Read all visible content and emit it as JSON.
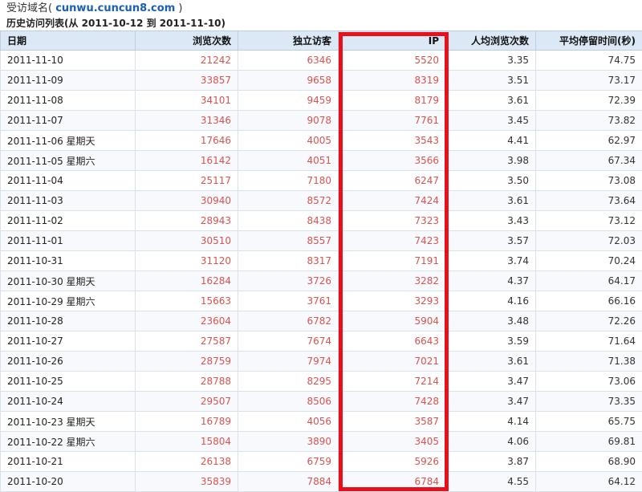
{
  "header": {
    "domain_label": "受访域名(",
    "domain": "cunwu.cuncun8.com",
    "domain_close": ")",
    "history_label": "历史访问列表(从 2011-10-12 到 2011-11-10)"
  },
  "table": {
    "columns": [
      "日期",
      "浏览次数",
      "独立访客",
      "IP",
      "人均浏览次数",
      "平均停留时间(秒)"
    ],
    "rows": [
      {
        "date": "2011-11-10",
        "pv": "21242",
        "uv": "6346",
        "ip": "5520",
        "avg_pv": "3.35",
        "avg_time": "74.75"
      },
      {
        "date": "2011-11-09",
        "pv": "33857",
        "uv": "9658",
        "ip": "8319",
        "avg_pv": "3.51",
        "avg_time": "73.17"
      },
      {
        "date": "2011-11-08",
        "pv": "34101",
        "uv": "9459",
        "ip": "8179",
        "avg_pv": "3.61",
        "avg_time": "72.39"
      },
      {
        "date": "2011-11-07",
        "pv": "31346",
        "uv": "9078",
        "ip": "7761",
        "avg_pv": "3.45",
        "avg_time": "73.82"
      },
      {
        "date": "2011-11-06 星期天",
        "pv": "17646",
        "uv": "4005",
        "ip": "3543",
        "avg_pv": "4.41",
        "avg_time": "62.97"
      },
      {
        "date": "2011-11-05 星期六",
        "pv": "16142",
        "uv": "4051",
        "ip": "3566",
        "avg_pv": "3.98",
        "avg_time": "67.34"
      },
      {
        "date": "2011-11-04",
        "pv": "25117",
        "uv": "7180",
        "ip": "6247",
        "avg_pv": "3.50",
        "avg_time": "73.08"
      },
      {
        "date": "2011-11-03",
        "pv": "30940",
        "uv": "8572",
        "ip": "7424",
        "avg_pv": "3.61",
        "avg_time": "73.64"
      },
      {
        "date": "2011-11-02",
        "pv": "28943",
        "uv": "8438",
        "ip": "7323",
        "avg_pv": "3.43",
        "avg_time": "73.12"
      },
      {
        "date": "2011-11-01",
        "pv": "30510",
        "uv": "8557",
        "ip": "7423",
        "avg_pv": "3.57",
        "avg_time": "72.03"
      },
      {
        "date": "2011-10-31",
        "pv": "31120",
        "uv": "8317",
        "ip": "7191",
        "avg_pv": "3.74",
        "avg_time": "70.24"
      },
      {
        "date": "2011-10-30 星期天",
        "pv": "16284",
        "uv": "3726",
        "ip": "3282",
        "avg_pv": "4.37",
        "avg_time": "64.17"
      },
      {
        "date": "2011-10-29 星期六",
        "pv": "15663",
        "uv": "3761",
        "ip": "3293",
        "avg_pv": "4.16",
        "avg_time": "66.16"
      },
      {
        "date": "2011-10-28",
        "pv": "23604",
        "uv": "6782",
        "ip": "5904",
        "avg_pv": "3.48",
        "avg_time": "72.26"
      },
      {
        "date": "2011-10-27",
        "pv": "27587",
        "uv": "7674",
        "ip": "6643",
        "avg_pv": "3.59",
        "avg_time": "71.64"
      },
      {
        "date": "2011-10-26",
        "pv": "28759",
        "uv": "7974",
        "ip": "7021",
        "avg_pv": "3.61",
        "avg_time": "71.38"
      },
      {
        "date": "2011-10-25",
        "pv": "28788",
        "uv": "8295",
        "ip": "7214",
        "avg_pv": "3.47",
        "avg_time": "73.06"
      },
      {
        "date": "2011-10-24",
        "pv": "29507",
        "uv": "8506",
        "ip": "7428",
        "avg_pv": "3.47",
        "avg_time": "73.35"
      },
      {
        "date": "2011-10-23 星期天",
        "pv": "16789",
        "uv": "4056",
        "ip": "3587",
        "avg_pv": "4.14",
        "avg_time": "65.75"
      },
      {
        "date": "2011-10-22 星期六",
        "pv": "15804",
        "uv": "3890",
        "ip": "3405",
        "avg_pv": "4.06",
        "avg_time": "69.81"
      },
      {
        "date": "2011-10-21",
        "pv": "26138",
        "uv": "6759",
        "ip": "5926",
        "avg_pv": "3.87",
        "avg_time": "68.90"
      },
      {
        "date": "2011-10-20",
        "pv": "35839",
        "uv": "7884",
        "ip": "6784",
        "avg_pv": "4.55",
        "avg_time": "64.12"
      }
    ]
  },
  "colors": {
    "value_red": "#d9534f",
    "highlight_frame": "#e8101a",
    "header_bg": "#dce8f5",
    "domain_link": "#1a5fb4"
  }
}
